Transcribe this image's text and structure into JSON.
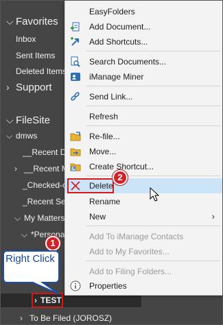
{
  "nav": {
    "favorites_label": "Favorites",
    "inbox_label": "Inbox",
    "sent_items_label": "Sent Items",
    "deleted_items_label": "Deleted Items",
    "support_label": "Support",
    "filesite_label": "FileSite",
    "dmws_label": "dmws",
    "recent_documents_label": "__Recent Do",
    "recent_matters_label": "__Recent Ma",
    "checked_out_label": "_Checked-o",
    "recent_searches_label": "_Recent Sea",
    "my_matters_label": "My Matters",
    "personal_label": "*Personal",
    "test_label": "TEST",
    "to_be_filed_label": "To Be Filed (JOROSZ)"
  },
  "menu": {
    "items": [
      {
        "label": "EasyFolders",
        "icon": "none"
      },
      {
        "label": "Add Document...",
        "icon": "add-document-icon"
      },
      {
        "label": "Add Shortcuts...",
        "icon": "add-shortcut-icon"
      },
      {
        "label": "Search Documents...",
        "icon": "search-documents-icon"
      },
      {
        "label": "iManage Miner",
        "icon": "imanage-miner-icon"
      },
      {
        "label": "Send Link...",
        "icon": "send-link-icon"
      },
      {
        "label": "Refresh",
        "icon": "none"
      },
      {
        "label": "Re-file...",
        "icon": "refile-folder-icon"
      },
      {
        "label": "Move...",
        "icon": "move-folder-icon"
      },
      {
        "label": "Create Shortcut...",
        "icon": "create-shortcut-icon"
      },
      {
        "label": "Delete",
        "icon": "delete-x-icon"
      },
      {
        "label": "Rename",
        "icon": "none"
      },
      {
        "label": "New",
        "icon": "none"
      },
      {
        "label": "Add To iManage Contacts",
        "icon": "none"
      },
      {
        "label": "Add to My Favorites...",
        "icon": "none"
      },
      {
        "label": "Add to Filing Folders...",
        "icon": "none"
      },
      {
        "label": "Properties",
        "icon": "info-icon"
      }
    ]
  },
  "annotations": {
    "step1": "1",
    "step2": "2",
    "callout_text": "Right Click"
  },
  "colors": {
    "nav_bg": "#454545",
    "menu_bg": "#f3f3f3",
    "highlight": "#cce4f7",
    "badge_red": "#d3222a",
    "callout_blue": "#15479a"
  }
}
